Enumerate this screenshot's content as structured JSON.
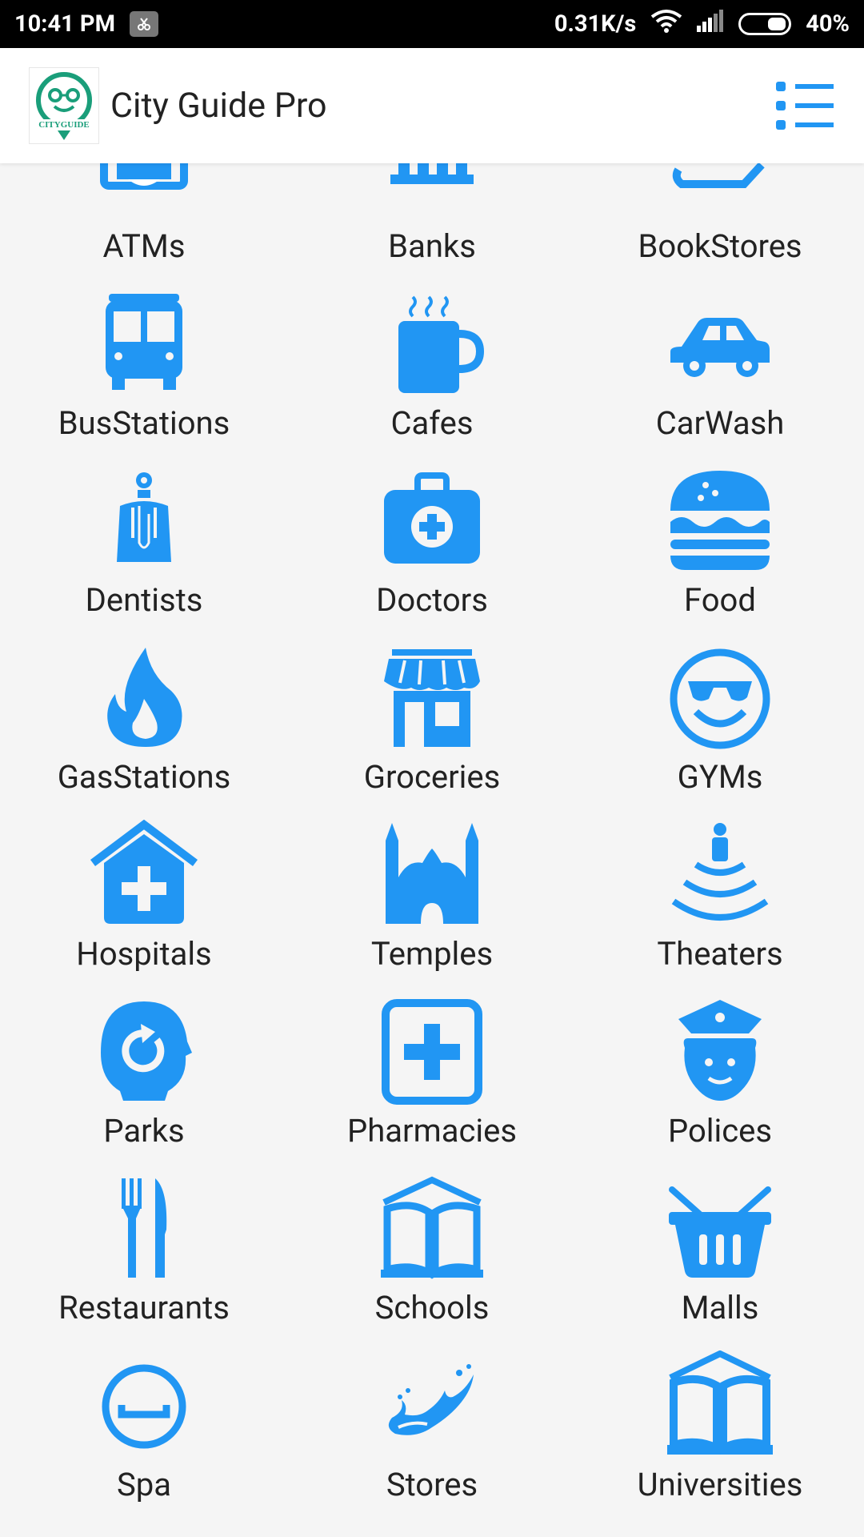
{
  "status_bar": {
    "time": "10:41 PM",
    "network_speed": "0.31K/s",
    "battery": "40%"
  },
  "app_bar": {
    "title": "City Guide Pro",
    "logo_text": "CITYGUIDE"
  },
  "categories": [
    {
      "label": "ATMs",
      "icon": "atm-icon"
    },
    {
      "label": "Banks",
      "icon": "bank-icon"
    },
    {
      "label": "BookStores",
      "icon": "books-icon"
    },
    {
      "label": "BusStations",
      "icon": "bus-icon"
    },
    {
      "label": "Cafes",
      "icon": "coffee-icon"
    },
    {
      "label": "CarWash",
      "icon": "car-icon"
    },
    {
      "label": "Dentists",
      "icon": "doctor-person-icon"
    },
    {
      "label": "Doctors",
      "icon": "medkit-icon"
    },
    {
      "label": "Food",
      "icon": "burger-icon"
    },
    {
      "label": "GasStations",
      "icon": "fire-icon"
    },
    {
      "label": "Groceries",
      "icon": "store-icon"
    },
    {
      "label": "GYMs",
      "icon": "sunglasses-smiley-icon"
    },
    {
      "label": "Hospitals",
      "icon": "hospital-icon"
    },
    {
      "label": "Temples",
      "icon": "mosque-icon"
    },
    {
      "label": "Theaters",
      "icon": "theater-icon"
    },
    {
      "label": "Parks",
      "icon": "head-refresh-icon"
    },
    {
      "label": "Pharmacies",
      "icon": "pharmacy-icon"
    },
    {
      "label": "Polices",
      "icon": "police-icon"
    },
    {
      "label": "Restaurants",
      "icon": "fork-knife-icon"
    },
    {
      "label": "Schools",
      "icon": "book-open-icon"
    },
    {
      "label": "Malls",
      "icon": "basket-icon"
    },
    {
      "label": "Spa",
      "icon": "spa-icon"
    },
    {
      "label": "Stores",
      "icon": "splash-icon"
    },
    {
      "label": "Universities",
      "icon": "book-house-icon"
    }
  ],
  "colors": {
    "accent": "#2196f3",
    "background": "#f5f5f5",
    "logo_green": "#1a9e7a"
  }
}
